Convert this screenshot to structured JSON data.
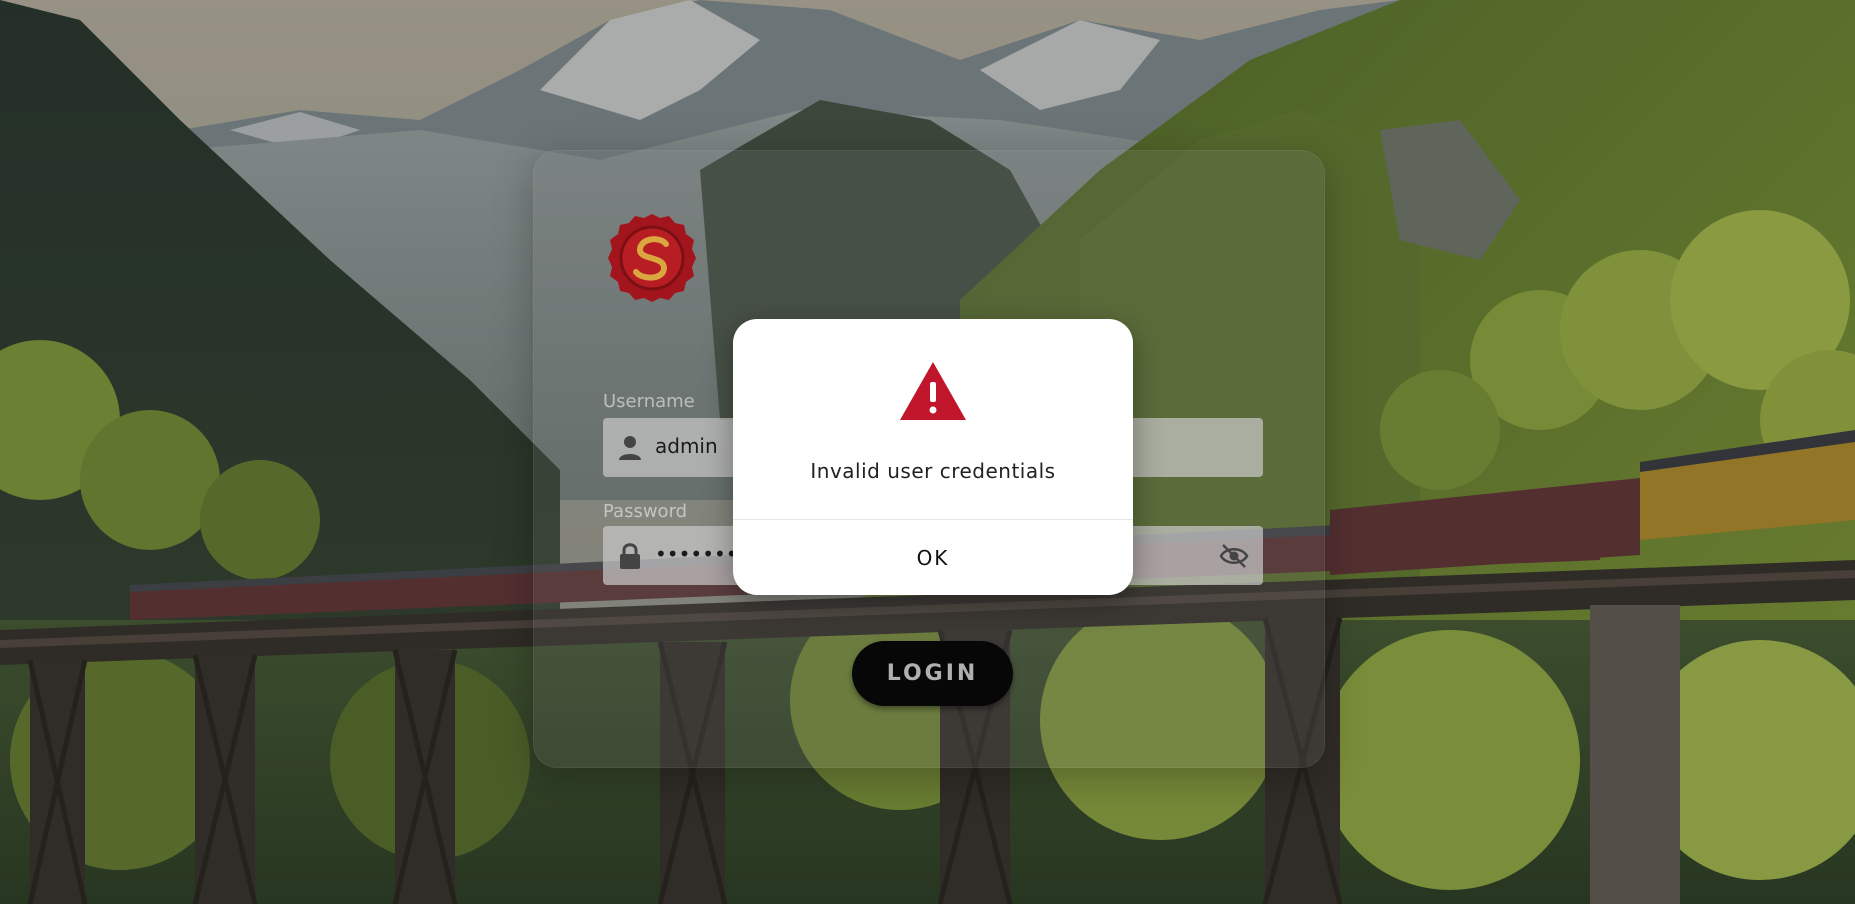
{
  "login_form": {
    "username_label": "Username",
    "username_value": "admin",
    "password_label": "Password",
    "password_value": "•••••••••",
    "login_button": "LOGIN"
  },
  "dialog": {
    "message": "Invalid user credentials",
    "ok_label": "OK"
  },
  "icons": {
    "logo": "wax-seal-logo",
    "username": "user-icon",
    "password": "lock-icon",
    "toggle_password": "eye-off-icon",
    "dialog": "warning-triangle-icon"
  },
  "colors": {
    "warning": "#c0152a",
    "seal": "#a3151d",
    "seal_mark": "#d9a640",
    "login_button_bg": "#070707",
    "dialog_bg": "#ffffff"
  }
}
